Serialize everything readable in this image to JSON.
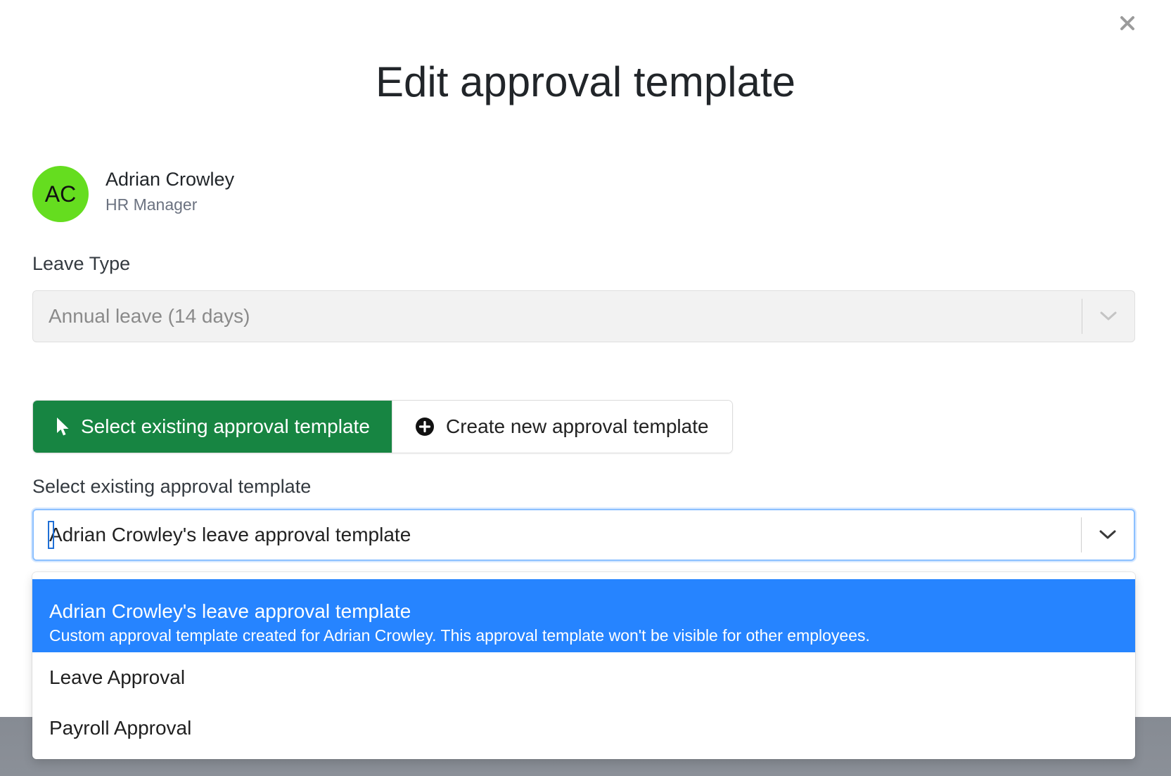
{
  "modal": {
    "title": "Edit approval template",
    "close_icon": "close-icon"
  },
  "employee": {
    "initials": "AC",
    "avatar_color": "#65dd1f",
    "name": "Adrian Crowley",
    "role": "HR Manager"
  },
  "leave_type": {
    "label": "Leave Type",
    "value": "Annual leave (14 days)",
    "disabled": true
  },
  "mode_toggle": {
    "selected_label": "Select existing approval template",
    "selected_icon": "pointer-icon",
    "other_label": "Create new approval template",
    "other_icon": "plus-circle-icon",
    "selected_color": "#178542"
  },
  "template_select": {
    "label": "Select existing approval template",
    "value": "Adrian Crowley's leave approval template",
    "options": [
      {
        "title": "Adrian Crowley's leave approval template",
        "description": "Custom approval template created for Adrian Crowley. This approval template won't be visible for other employees.",
        "highlighted": true
      },
      {
        "title": "Leave Approval"
      },
      {
        "title": "Payroll Approval"
      }
    ],
    "highlight_color": "#2684ff"
  }
}
